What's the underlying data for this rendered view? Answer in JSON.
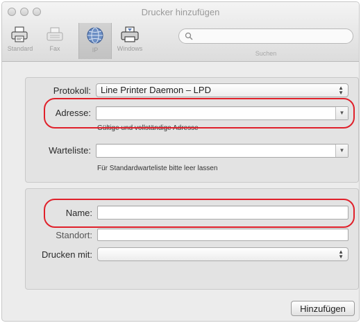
{
  "window": {
    "title": "Drucker hinzufügen"
  },
  "toolbar": {
    "items": [
      {
        "label": "Standard",
        "icon": "standard-printer-icon"
      },
      {
        "label": "Fax",
        "icon": "fax-icon"
      },
      {
        "label": "IP",
        "icon": "globe-icon",
        "selected": true
      },
      {
        "label": "Windows",
        "icon": "windows-printer-icon"
      }
    ],
    "search": {
      "label": "Suchen",
      "placeholder": ""
    }
  },
  "form": {
    "protokoll": {
      "label": "Protokoll:",
      "value": "Line Printer Daemon – LPD"
    },
    "adresse": {
      "label": "Adresse:",
      "value": "",
      "hint": "Gültige und vollständige Adresse"
    },
    "warteliste": {
      "label": "Warteliste:",
      "value": "",
      "hint": "Für Standardwarteliste bitte leer lassen"
    },
    "name": {
      "label": "Name:",
      "value": ""
    },
    "standort": {
      "label": "Standort:",
      "value": ""
    },
    "drucken_mit": {
      "label": "Drucken mit:",
      "value": ""
    }
  },
  "actions": {
    "add_label": "Hinzufügen"
  },
  "colors": {
    "highlight": "#e0202a",
    "window_bg": "#ececec",
    "panel_bg": "#e3e3e3"
  }
}
